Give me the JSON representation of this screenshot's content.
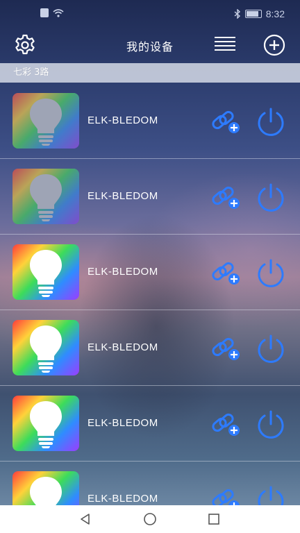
{
  "status_bar": {
    "time": "8:32"
  },
  "app_bar": {
    "title": "我的设备"
  },
  "group": {
    "label": "七彩 3路"
  },
  "devices": [
    {
      "name": "ELK-BLEDOM",
      "dimmed": true
    },
    {
      "name": "ELK-BLEDOM",
      "dimmed": true
    },
    {
      "name": "ELK-BLEDOM",
      "dimmed": false
    },
    {
      "name": "ELK-BLEDOM",
      "dimmed": false
    },
    {
      "name": "ELK-BLEDOM",
      "dimmed": false
    },
    {
      "name": "ELK-BLEDOM",
      "dimmed": false
    }
  ],
  "icons": {
    "settings": "gear-icon",
    "list": "menu-icon",
    "add": "add-circle-icon",
    "bind": "link-add-icon",
    "power": "power-icon"
  },
  "colors": {
    "accent_blue": "#2d7bff",
    "text": "#ffffff",
    "header_bar": "#dde1ea"
  }
}
